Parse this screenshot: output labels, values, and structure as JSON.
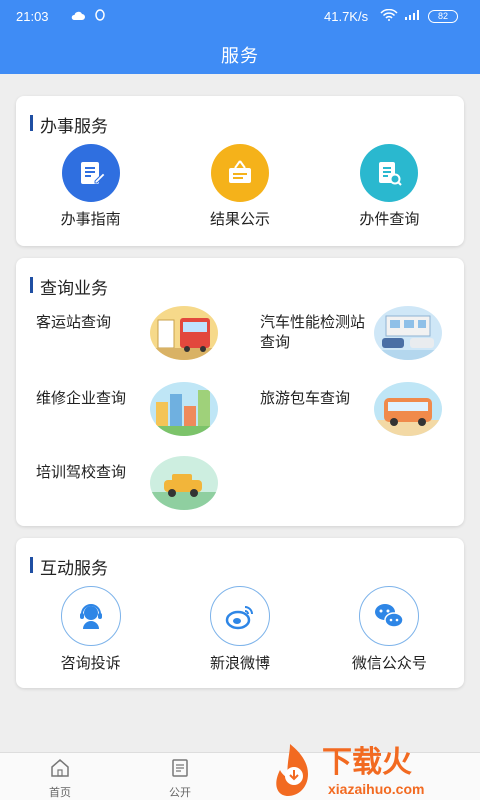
{
  "status": {
    "time": "21:03",
    "net_speed": "41.7K/s",
    "battery": "82"
  },
  "header": {
    "title": "服务"
  },
  "sections": {
    "office": {
      "title": "办事服务",
      "items": [
        {
          "label": "办事指南",
          "icon": "form-pen-icon",
          "color": "#2f6fe0"
        },
        {
          "label": "结果公示",
          "icon": "signboard-icon",
          "color": "#f5b21a"
        },
        {
          "label": "办件查询",
          "icon": "document-search-icon",
          "color": "#2ab8cf"
        }
      ]
    },
    "query": {
      "title": "查询业务",
      "items": [
        {
          "label": "客运站查询",
          "image": "bus-station-image"
        },
        {
          "label": "汽车性能检测站查询",
          "image": "car-inspection-image"
        },
        {
          "label": "维修企业查询",
          "image": "city-buildings-image"
        },
        {
          "label": "旅游包车查询",
          "image": "tour-bus-image"
        },
        {
          "label": "培训驾校查询",
          "image": "driving-school-image"
        }
      ]
    },
    "interact": {
      "title": "互动服务",
      "items": [
        {
          "label": "咨询投诉",
          "icon": "customer-service-icon"
        },
        {
          "label": "新浪微博",
          "icon": "weibo-icon"
        },
        {
          "label": "微信公众号",
          "icon": "wechat-icon"
        }
      ]
    }
  },
  "tabbar": {
    "items": [
      {
        "label": "首页",
        "icon": "home-icon"
      },
      {
        "label": "公开",
        "icon": "document-icon"
      }
    ]
  },
  "watermark": {
    "text": "下载火",
    "url": "xiazaihuo.com"
  },
  "colors": {
    "primary": "#3f8cf5",
    "accent_dark": "#1f4fa3",
    "icon_blue": "#2e86e6"
  }
}
